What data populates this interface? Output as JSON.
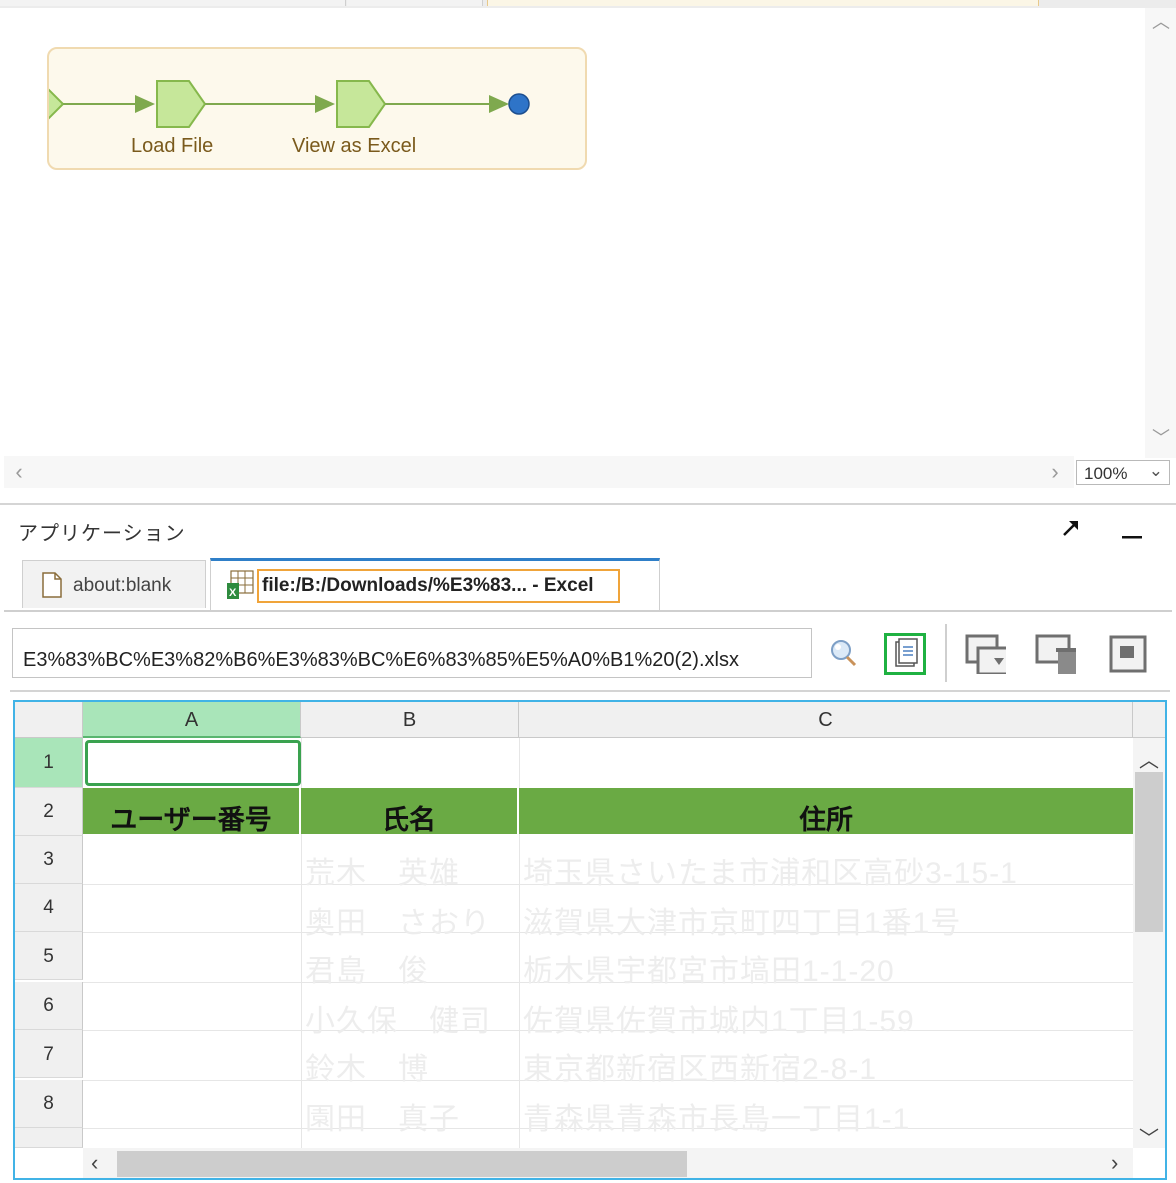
{
  "flow": {
    "steps": [
      {
        "label": "Load File"
      },
      {
        "label": "View as Excel"
      }
    ]
  },
  "canvas": {
    "zoom": "100%",
    "scroll_left_icon": "chevron-left-icon",
    "scroll_right_icon": "chevron-right-icon"
  },
  "panel": {
    "title": "アプリケーション",
    "icons": [
      "pop-out-icon",
      "minimize-icon"
    ]
  },
  "tabs": [
    {
      "label": "about:blank",
      "icon": "document-icon"
    },
    {
      "label": "file:/B:/Downloads/%E3%83... - Excel",
      "icon": "excel-file-icon",
      "active": true
    }
  ],
  "address": {
    "value": "E3%83%BC%E3%82%B6%E3%83%BC%E6%83%85%E5%A0%B1%20(2).xlsx"
  },
  "toolbar": {
    "buttons": [
      "inspect-icon",
      "capture-icon",
      "window-icon",
      "delete-window-icon",
      "preview-icon"
    ]
  },
  "sheet": {
    "columns": [
      "A",
      "B",
      "C"
    ],
    "rows": [
      "1",
      "2",
      "3",
      "4",
      "5",
      "6",
      "7",
      "8"
    ],
    "header": [
      "ユーザー番号",
      "氏名",
      "住所"
    ],
    "data": [
      [
        "荒木　英雄",
        "埼玉県さいたま市浦和区高砂3-15-1"
      ],
      [
        "奥田　さおり",
        "滋賀県大津市京町四丁目1番1号"
      ],
      [
        "君島　俊",
        "栃木県宇都宮市塙田1-1-20"
      ],
      [
        "小久保　健司",
        "佐賀県佐賀市城内1丁目1-59"
      ],
      [
        "鈴木　博",
        "東京都新宿区西新宿2-8-1"
      ],
      [
        "園田　真子",
        "青森県青森市長島一丁目1-1"
      ]
    ],
    "active_cell": "A1",
    "header_color": "#6aaa44",
    "selection_color": "#3aa24f"
  }
}
